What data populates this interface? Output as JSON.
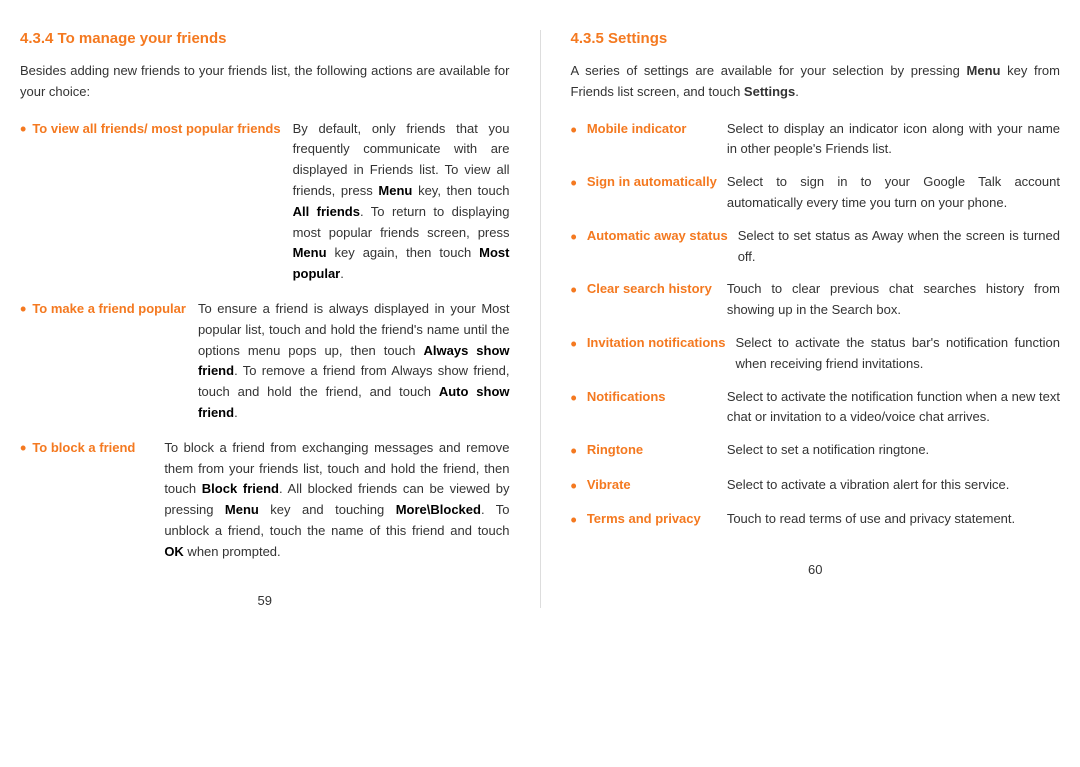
{
  "left": {
    "heading": "4.3.4   To manage your friends",
    "intro": "Besides adding new friends to your friends list, the following actions are available for your choice:",
    "bullets": [
      {
        "label": "To view all friends/ most popular friends",
        "desc": "By default, only friends that you frequently communicate with are displayed in Friends list. To view all friends, press Menu key, then touch All friends. To return to displaying most popular friends screen, press Menu key again, then touch Most popular."
      },
      {
        "label": "To make a friend popular",
        "desc": "To ensure a friend is always displayed in your Most popular list, touch and hold the friend's name until the options menu pops up, then touch Always show friend. To remove a friend from Always show friend, touch and hold the friend, and touch Auto show friend."
      },
      {
        "label": "To block a friend",
        "desc": "To block a friend from exchanging messages and remove them from your friends list, touch and hold the friend, then touch Block friend. All blocked friends can be viewed by pressing Menu key and touching More\\Blocked. To unblock a friend, touch the name of this friend and touch OK when prompted."
      }
    ],
    "page_number": "59"
  },
  "right": {
    "heading": "4.3.5   Settings",
    "intro_before_menu": "A series of settings are available for your selection by pressing",
    "intro_menu_word": "Menu",
    "intro_after_menu": "key from Friends list screen, and touch",
    "intro_settings_word": "Settings",
    "intro_end": ".",
    "settings": [
      {
        "key": "Mobile indicator",
        "value": "Select to display an indicator icon along with your name in other people's Friends list."
      },
      {
        "key": "Sign in automatically",
        "value": "Select to sign in to your Google Talk account automatically every time you turn on your phone."
      },
      {
        "key": "Automatic away status",
        "value": "Select to set status as Away when the screen is turned off."
      },
      {
        "key": "Clear search history",
        "value": "Touch to clear previous chat searches history from showing up in the Search box."
      },
      {
        "key": "Invitation notifications",
        "value": "Select to activate the status bar's notification function when receiving friend invitations."
      },
      {
        "key": "Notifications",
        "value": "Select to activate the notification function when a new text chat or invitation to a video/voice chat arrives."
      },
      {
        "key": "Ringtone",
        "value": "Select to set a notification ringtone."
      },
      {
        "key": "Vibrate",
        "value": "Select to activate a vibration alert for this service."
      },
      {
        "key": "Terms and privacy",
        "value": "Touch to read terms of use and privacy statement."
      }
    ],
    "page_number": "60"
  }
}
